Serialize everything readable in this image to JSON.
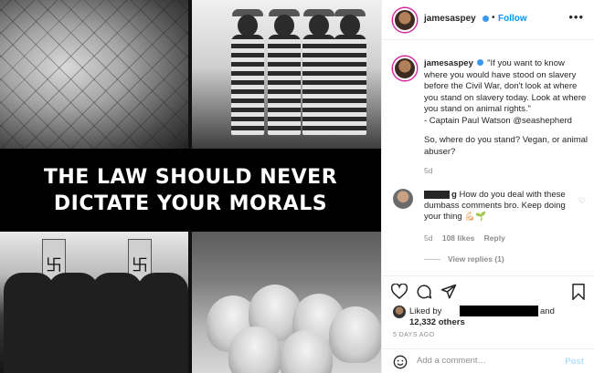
{
  "post": {
    "banner_lines": [
      "THE LAW SHOULD NEVER",
      "DICTATE YOUR MORALS"
    ]
  },
  "header": {
    "username": "jamesaspey",
    "separator": "•",
    "follow_label": "Follow",
    "more_icon": "more-options-icon"
  },
  "caption": {
    "username": "jamesaspey",
    "quote": "\"If you want to know where you would have stood on slavery before the Civil War, don't look at where you stand on slavery today. Look at where you stand on animal rights.\"",
    "attribution": "- Captain Paul Watson",
    "mention": "@seashepherd",
    "question": "So, where do you stand? Vegan, or animal abuser?",
    "age": "5d"
  },
  "comment": {
    "username_suffix": "g",
    "text": "How do you deal with these dumbass comments bro. Keep doing your thing 💪🏻🌱",
    "age": "5d",
    "likes": "108 likes",
    "reply_label": "Reply",
    "view_replies": "View replies (1)"
  },
  "likes": {
    "liked_by": "Liked by",
    "and": "and",
    "others": "12,332 others"
  },
  "time_ago": "5 DAYS AGO",
  "add_comment": {
    "placeholder": "Add a comment…",
    "post_label": "Post"
  },
  "colors": {
    "accent_blue": "#0095f6",
    "post_disabled": "#b2dffc",
    "muted_text": "#8e8e8e"
  }
}
